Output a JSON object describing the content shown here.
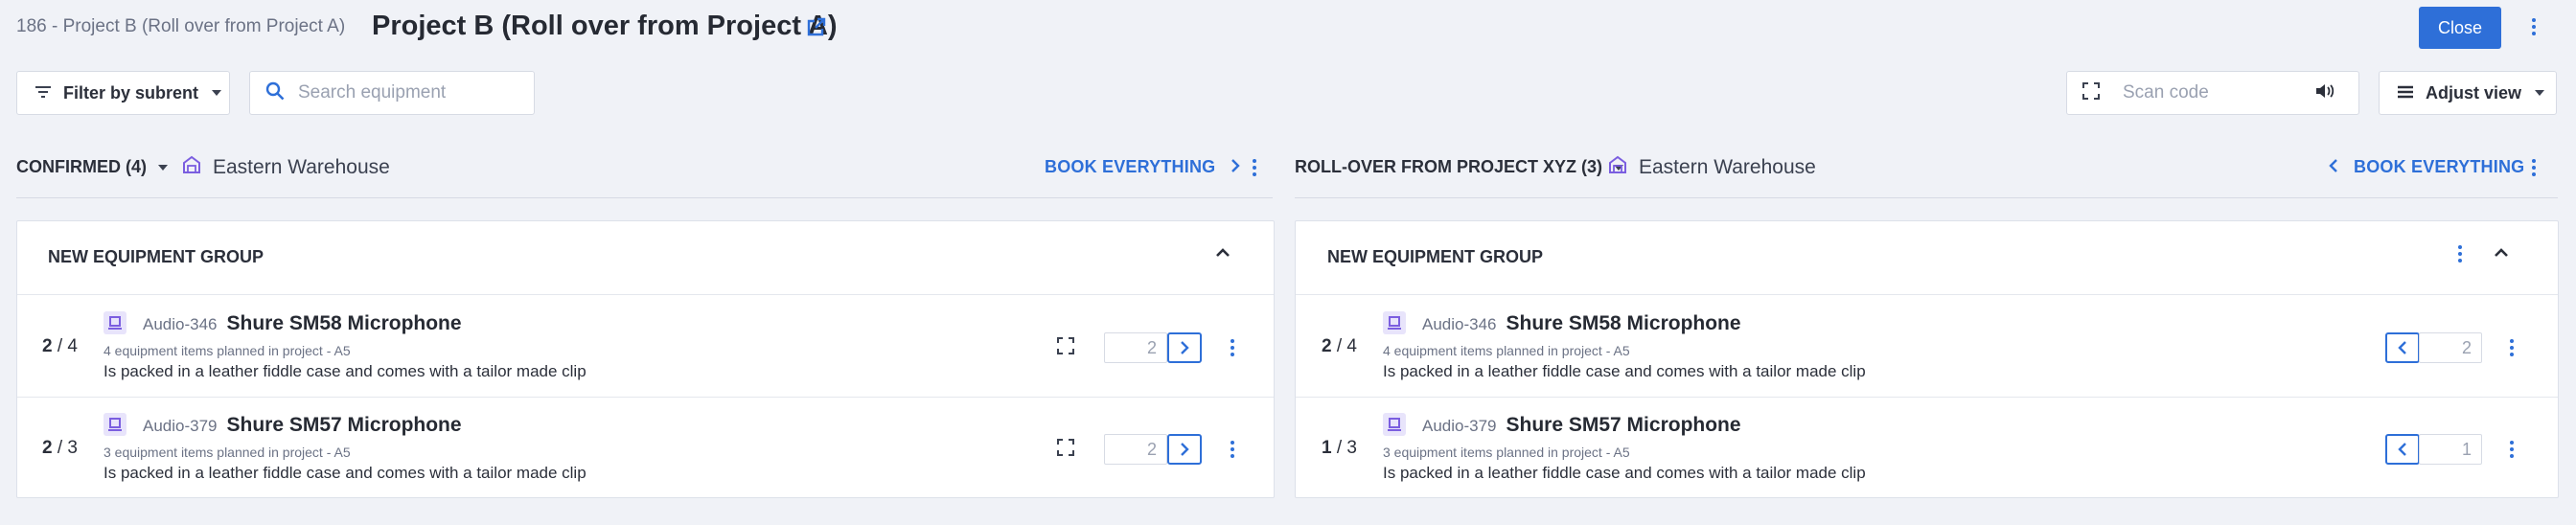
{
  "header": {
    "crumb": "186 - Project B (Roll over from Project A)",
    "title": "Project B (Roll over from Project A)",
    "close_label": "Close"
  },
  "toolbar": {
    "filter_label": "Filter by subrent",
    "search_placeholder": "Search equipment",
    "scan_placeholder": "Scan code",
    "adjust_label": "Adjust view"
  },
  "left": {
    "section_title": "CONFIRMED (4)",
    "warehouse": "Eastern Warehouse",
    "book_label": "BOOK EVERYTHING",
    "group_title": "NEW EQUIPMENT GROUP",
    "items": [
      {
        "count": "2",
        "total": "/ 4",
        "code": "Audio-346",
        "name": "Shure SM58 Microphone",
        "sub": "4 equipment items planned in project - A5",
        "desc": "Is packed in a leather fiddle case and comes with a tailor made clip",
        "qty": "2"
      },
      {
        "count": "2",
        "total": "/ 3",
        "code": "Audio-379",
        "name": "Shure SM57 Microphone",
        "sub": "3 equipment items planned in project - A5",
        "desc": "Is packed in a leather fiddle case and comes with a tailor made clip",
        "qty": "2"
      }
    ]
  },
  "right": {
    "section_title": "ROLL-OVER FROM PROJECT XYZ (3)",
    "warehouse": "Eastern Warehouse",
    "book_label": "BOOK EVERYTHING",
    "group_title": "NEW EQUIPMENT GROUP",
    "items": [
      {
        "count": "2",
        "total": "/ 4",
        "code": "Audio-346",
        "name": "Shure SM58 Microphone",
        "sub": "4 equipment items planned in project - A5",
        "desc": "Is packed in a leather fiddle case and comes with a tailor made clip",
        "qty": "2"
      },
      {
        "count": "1",
        "total": "/ 3",
        "code": "Audio-379",
        "name": "Shure SM57 Microphone",
        "sub": "3 equipment items planned in project - A5",
        "desc": "Is packed in a leather fiddle case and comes with a tailor made clip",
        "qty": "1"
      }
    ]
  },
  "colors": {
    "accent": "#2e6fd8",
    "background": "#f0f2f7",
    "equipment_icon": "#7b5ee0"
  },
  "icons": [
    "external-link-icon",
    "filter-icon",
    "search-icon",
    "scan-icon",
    "speaker-icon",
    "list-icon",
    "warehouse-icon",
    "chevron-right-icon",
    "chevron-left-icon",
    "chevron-up-icon",
    "more-vertical-icon",
    "equipment-icon"
  ]
}
